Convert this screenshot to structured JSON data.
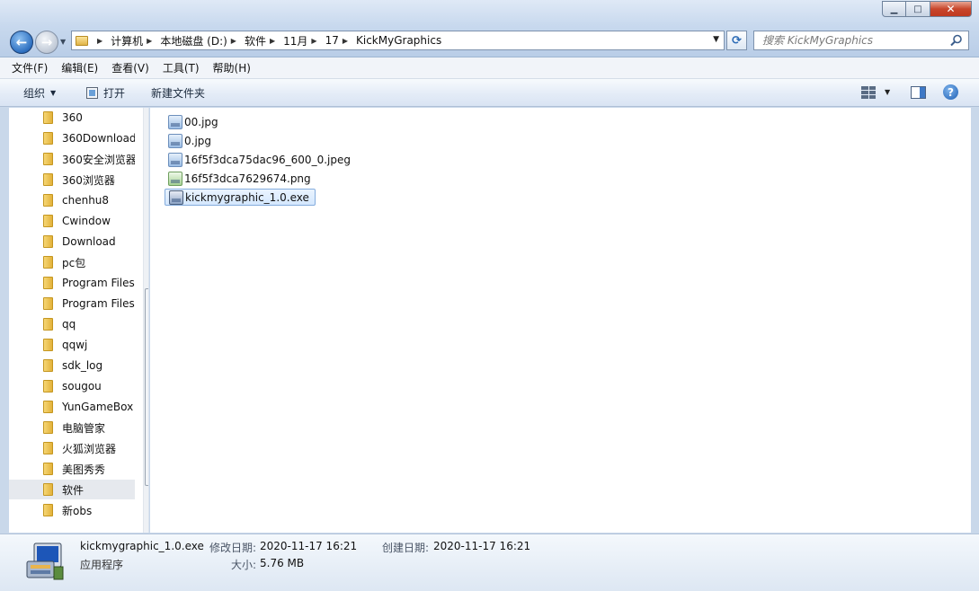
{
  "window": {
    "min_glyph": "▁",
    "max_glyph": "□",
    "close_glyph": "✕"
  },
  "address": {
    "crumbs": [
      "计算机",
      "本地磁盘 (D:)",
      "软件",
      "11月",
      "17",
      "KickMyGraphics"
    ],
    "search_placeholder": "搜索 KickMyGraphics"
  },
  "menu": [
    "文件(F)",
    "编辑(E)",
    "查看(V)",
    "工具(T)",
    "帮助(H)"
  ],
  "toolbar": {
    "organize": "组织",
    "open": "打开",
    "new_folder": "新建文件夹"
  },
  "nav": {
    "items": [
      "360",
      "360Download",
      "360安全浏览器",
      "360浏览器",
      "chenhu8",
      "Cwindow",
      "Download",
      "pc包",
      "Program Files",
      "Program Files",
      "qq",
      "qqwj",
      "sdk_log",
      "sougou",
      "YunGameBox",
      "电脑管家",
      "火狐浏览器",
      "美图秀秀",
      "软件",
      "新obs"
    ],
    "selected_index": 18
  },
  "files": [
    {
      "name": "00.jpg",
      "type": "jpg"
    },
    {
      "name": "0.jpg",
      "type": "jpg"
    },
    {
      "name": "16f5f3dca75dac96_600_0.jpeg",
      "type": "jpg"
    },
    {
      "name": "16f5f3dca7629674.png",
      "type": "png"
    },
    {
      "name": "kickmygraphic_1.0.exe",
      "type": "exe"
    }
  ],
  "selected_file_index": 4,
  "details": {
    "name": "kickmygraphic_1.0.exe",
    "type": "应用程序",
    "modified_label": "修改日期:",
    "modified_value": "2020-11-17 16:21",
    "created_label": "创建日期:",
    "created_value": "2020-11-17 16:21",
    "size_label": "大小:",
    "size_value": "5.76 MB"
  },
  "colors": {
    "accent": "#2d6fc0",
    "selection": "#d4e7fd",
    "selection_border": "#84acdd"
  }
}
